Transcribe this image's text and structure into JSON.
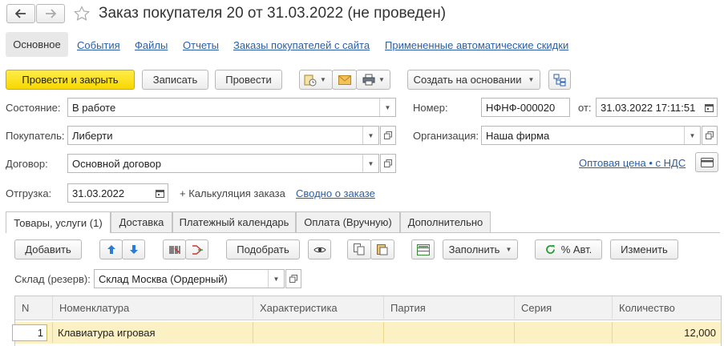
{
  "window": {
    "title": "Заказ покупателя 20 от 31.03.2022 (не проведен)"
  },
  "nav_tabs": [
    {
      "label": "Основное"
    },
    {
      "label": "События"
    },
    {
      "label": "Файлы"
    },
    {
      "label": "Отчеты"
    },
    {
      "label": "Заказы покупателей с сайта"
    },
    {
      "label": "Примененные автоматические скидки"
    }
  ],
  "toolbar": {
    "post_close_label": "Провести и закрыть",
    "save_label": "Записать",
    "post_label": "Провести",
    "create_based_label": "Создать на основании"
  },
  "form": {
    "state_label": "Состояние:",
    "state_value": "В работе",
    "buyer_label": "Покупатель:",
    "buyer_value": "Либерти",
    "contract_label": "Договор:",
    "contract_value": "Основной договор",
    "shipment_label": "Отгрузка:",
    "shipment_value": "31.03.2022",
    "calc_label": "+ Калькуляция заказа",
    "summary_link": "Сводно о заказе",
    "number_label": "Номер:",
    "number_value": "НФНФ-000020",
    "date_label": "от:",
    "date_value": "31.03.2022 17:11:51",
    "org_label": "Организация:",
    "org_value": "Наша фирма",
    "price_link": "Оптовая цена • с НДС"
  },
  "content_tabs": [
    {
      "label": "Товары, услуги (1)"
    },
    {
      "label": "Доставка"
    },
    {
      "label": "Платежный календарь"
    },
    {
      "label": "Оплата (Вручную)"
    },
    {
      "label": "Дополнительно"
    }
  ],
  "table_toolbar": {
    "add_label": "Добавить",
    "pick_label": "Подобрать",
    "fill_label": "Заполнить",
    "auto_discount_label": "% Авт.",
    "edit_label": "Изменить"
  },
  "warehouse": {
    "label": "Склад (резерв):",
    "value": "Склад Москва (Ордерный)"
  },
  "table": {
    "columns": [
      "N",
      "Номенклатура",
      "Характеристика",
      "Партия",
      "Серия",
      "Количество"
    ],
    "rows": [
      {
        "n": "1",
        "item": "Клавиатура игровая",
        "characteristic": "",
        "batch": "",
        "series": "",
        "quantity": "12,000"
      }
    ]
  },
  "colors": {
    "primary_button": "#f7d800",
    "link": "#2a5fa8",
    "selected_row": "#fbf1c4"
  }
}
